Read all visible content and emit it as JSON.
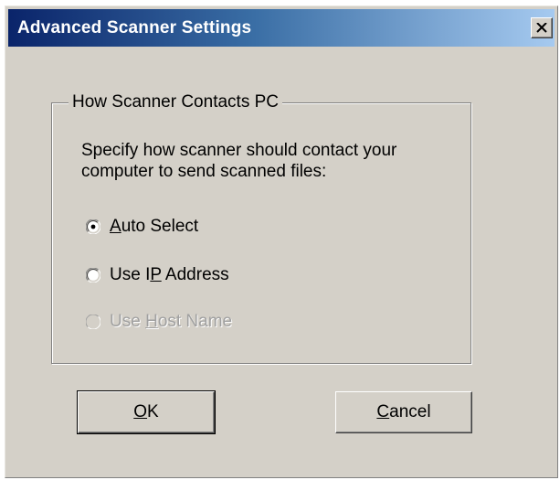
{
  "window": {
    "title": "Advanced Scanner Settings",
    "close_icon": "close-icon"
  },
  "group": {
    "legend": "How Scanner Contacts PC",
    "description_line1": "Specify how scanner should contact your",
    "description_line2": "computer to send scanned files:"
  },
  "options": [
    {
      "pre": "",
      "mnemonic": "A",
      "post": "uto Select",
      "selected": true,
      "enabled": true
    },
    {
      "pre": "Use I",
      "mnemonic": "P",
      "post": " Address",
      "selected": false,
      "enabled": true
    },
    {
      "pre": "Use ",
      "mnemonic": "H",
      "post": "ost Name",
      "selected": false,
      "enabled": false
    }
  ],
  "buttons": {
    "ok": {
      "mnemonic": "O",
      "post": "K"
    },
    "cancel": {
      "mnemonic": "C",
      "post": "ancel"
    }
  },
  "colors": {
    "title_bar_start": "#0a246a",
    "title_bar_end": "#a6caf0",
    "face": "#d4d0c8"
  }
}
